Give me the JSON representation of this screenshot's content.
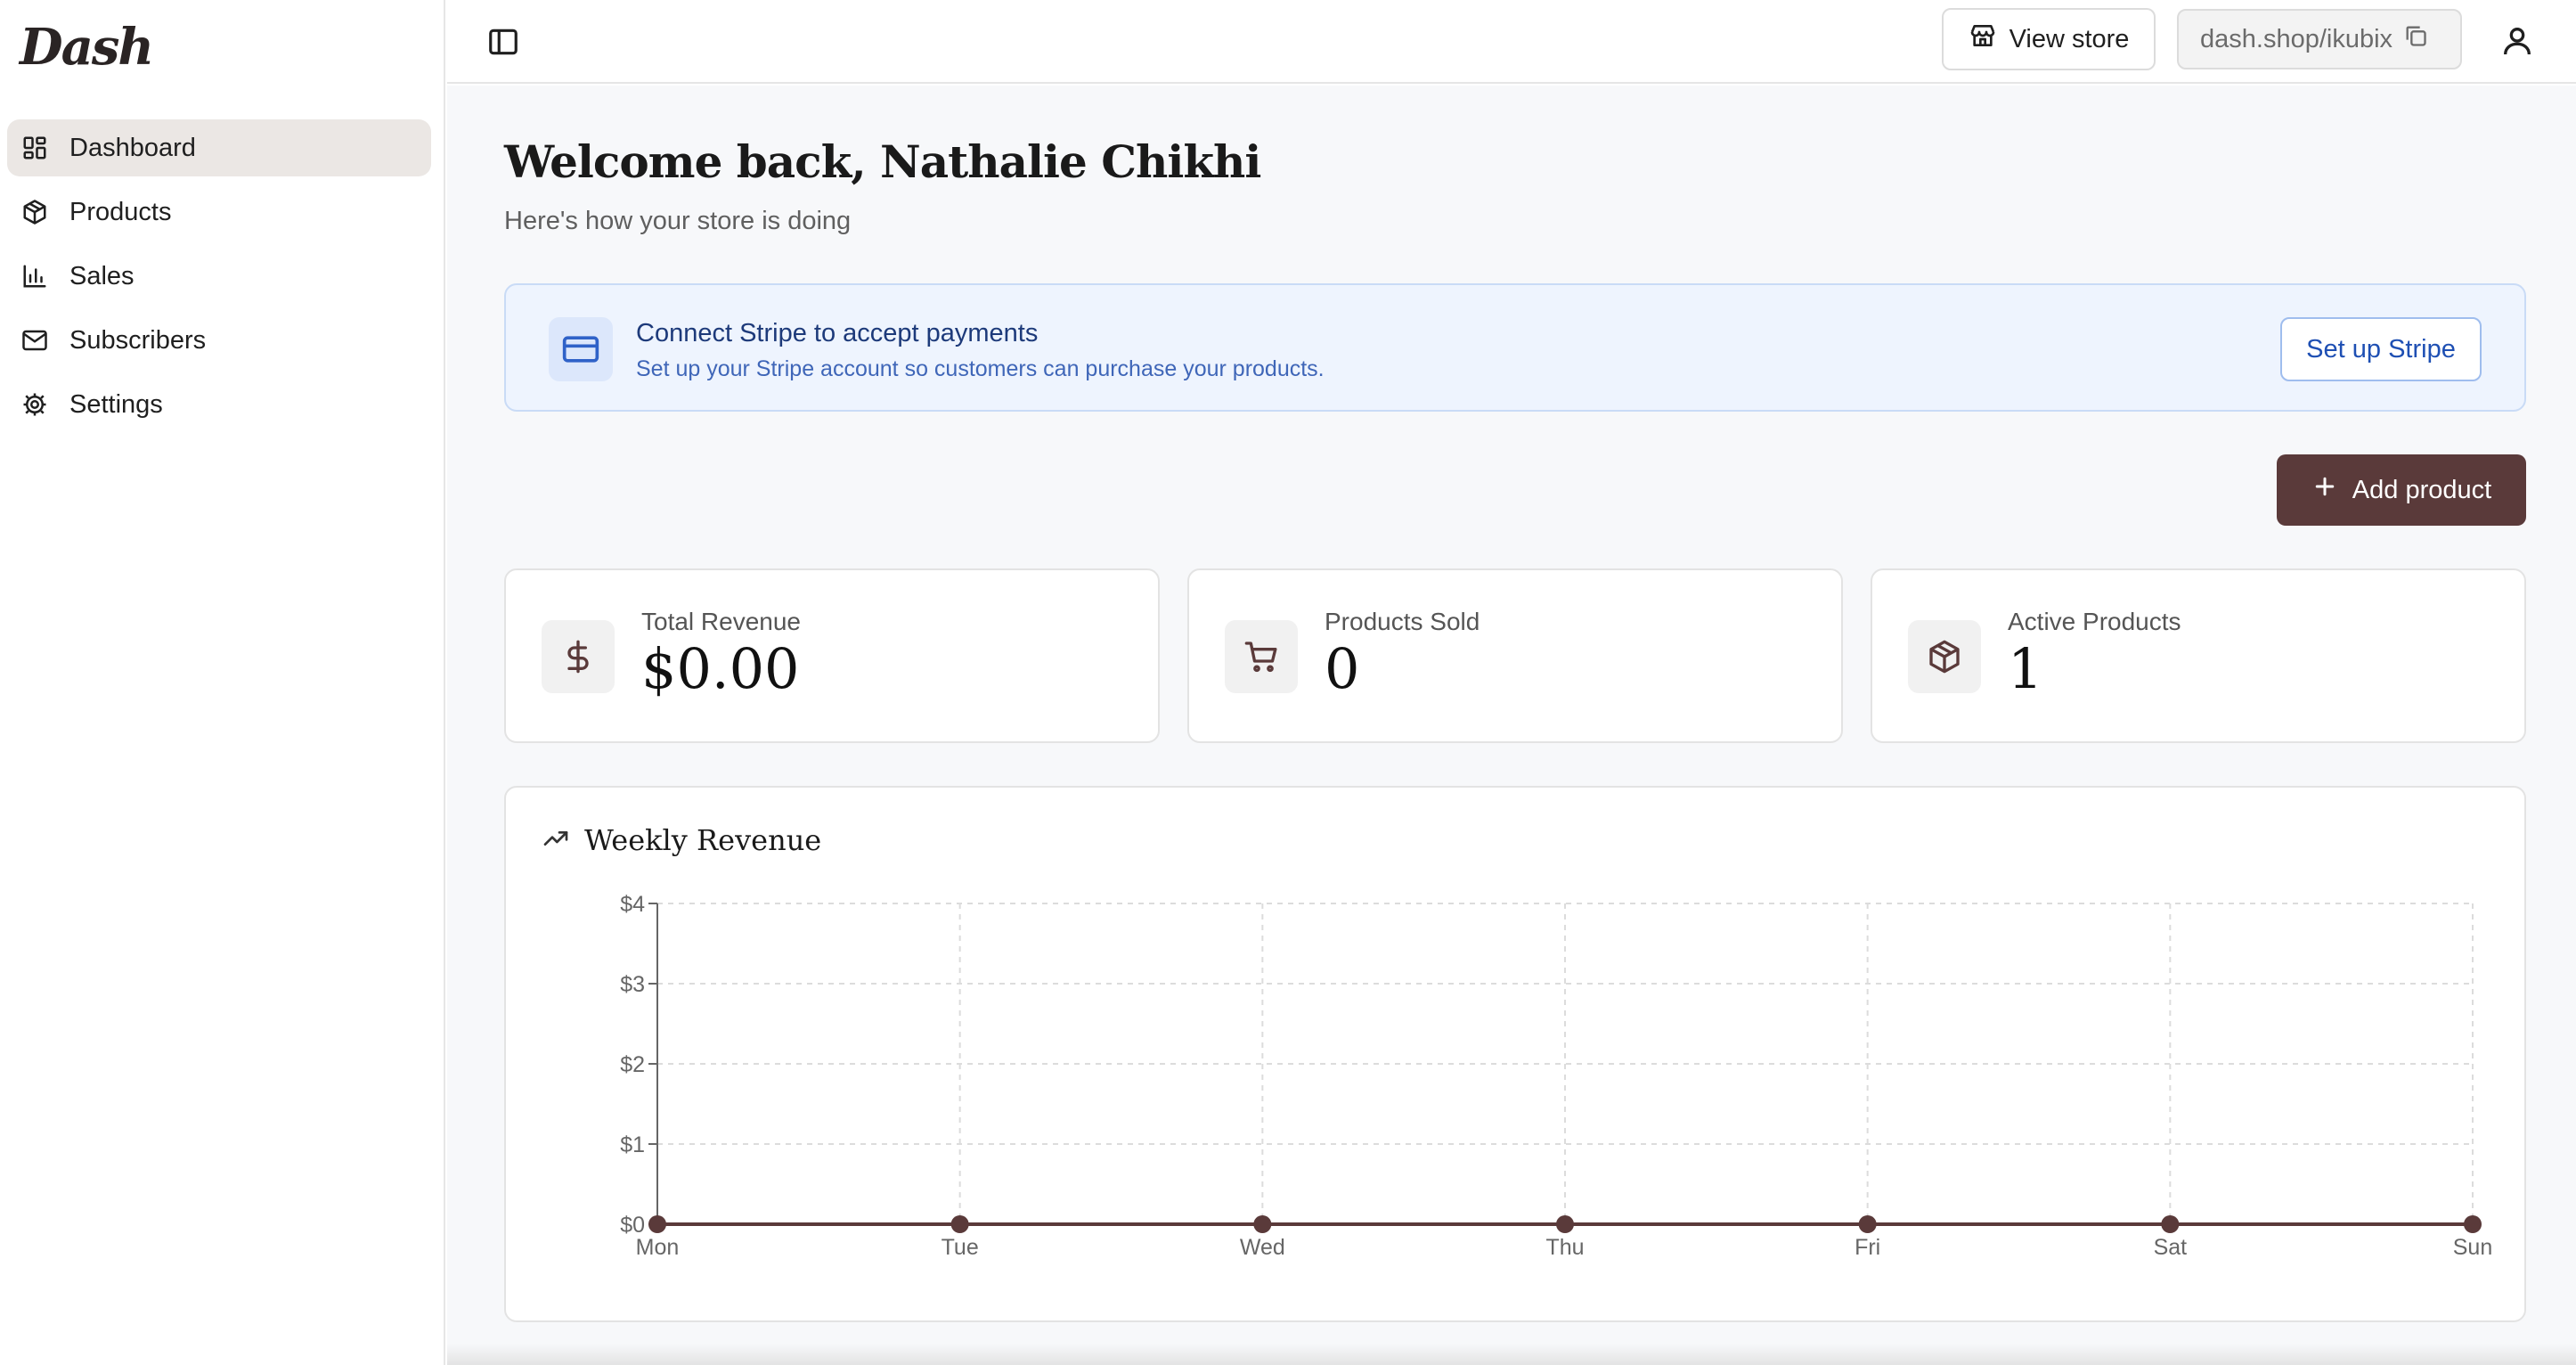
{
  "app": {
    "logo": "Dash"
  },
  "sidebar": {
    "items": [
      {
        "label": "Dashboard",
        "icon": "dashboard-icon",
        "active": true
      },
      {
        "label": "Products",
        "icon": "box-icon",
        "active": false
      },
      {
        "label": "Sales",
        "icon": "bar-chart-icon",
        "active": false
      },
      {
        "label": "Subscribers",
        "icon": "mail-icon",
        "active": false
      },
      {
        "label": "Settings",
        "icon": "gear-icon",
        "active": false
      }
    ]
  },
  "header": {
    "view_store_label": "View store",
    "store_url": "dash.shop/ikubix"
  },
  "main": {
    "welcome": "Welcome back, Nathalie Chikhi",
    "subtitle": "Here's how your store is doing",
    "stripe": {
      "title": "Connect Stripe to accept payments",
      "description": "Set up your Stripe account so customers can purchase your products.",
      "button": "Set up Stripe"
    },
    "add_product_label": "Add product",
    "stats": [
      {
        "label": "Total Revenue",
        "value": "$0.00",
        "icon": "dollar-icon"
      },
      {
        "label": "Products Sold",
        "value": "0",
        "icon": "cart-icon"
      },
      {
        "label": "Active Products",
        "value": "1",
        "icon": "box-icon"
      }
    ],
    "chart_title": "Weekly Revenue"
  },
  "colors": {
    "accent": "#5a3a3a",
    "active_nav": "#ebe7e4",
    "stripe_bg": "#eef4fe",
    "stripe_text": "#1d3a7a"
  },
  "chart_data": {
    "type": "line",
    "title": "Weekly Revenue",
    "categories": [
      "Mon",
      "Tue",
      "Wed",
      "Thu",
      "Fri",
      "Sat",
      "Sun"
    ],
    "values": [
      0,
      0,
      0,
      0,
      0,
      0,
      0
    ],
    "y_ticks": [
      "$0",
      "$1",
      "$2",
      "$3",
      "$4"
    ],
    "ylim": [
      0,
      4
    ],
    "grid": true,
    "xlabel": "",
    "ylabel": ""
  }
}
